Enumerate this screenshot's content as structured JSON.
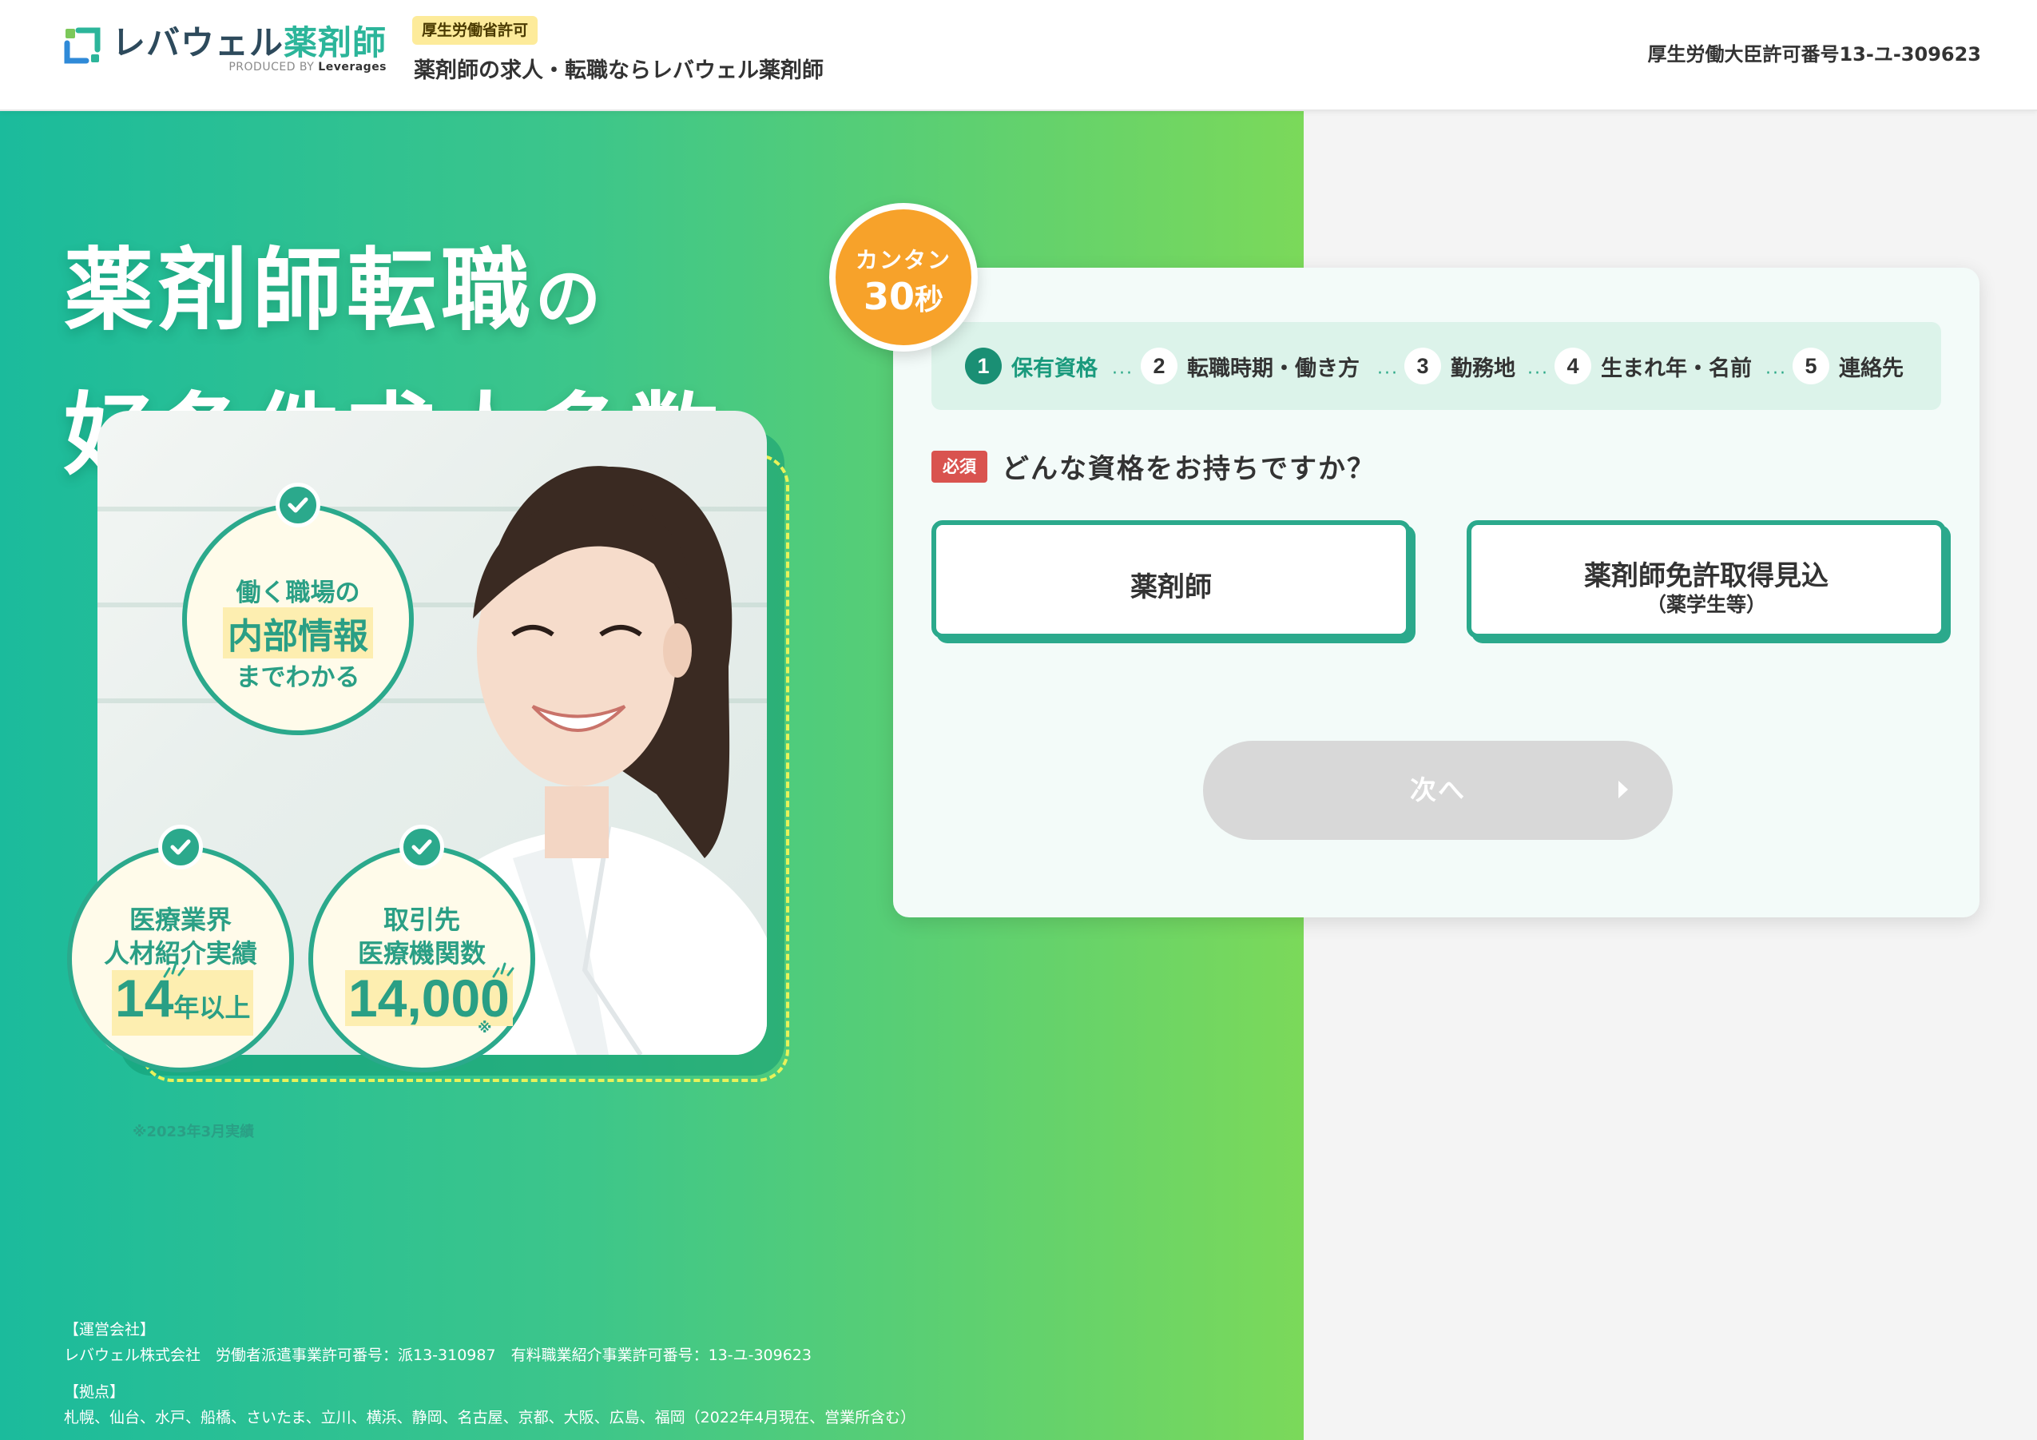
{
  "header": {
    "logo_text_main": "レバウェル",
    "logo_text_accent": "薬剤師",
    "logo_sub_prefix": "PRODUCED BY",
    "logo_sub_brand": "Leverages",
    "permit_badge": "厚生労働省許可",
    "tagline": "薬剤師の求人・転職ならレバウェル薬剤師",
    "license": "厚生労働大臣許可番号13-ユ-309623"
  },
  "hero": {
    "title_line1_main": "薬剤師転職",
    "title_line1_particle": "の",
    "title_line2": "好条件求人多数",
    "features": [
      {
        "line1": "働く職場の",
        "line2": "内部情報",
        "line3": "までわかる"
      },
      {
        "line1": "医療業界",
        "line2": "人材紹介実績",
        "number": "14",
        "unit": "年以上"
      },
      {
        "line1": "取引先",
        "line2": "医療機関数",
        "number": "14,000",
        "mark": "※"
      }
    ],
    "note": "※2023年3月実績"
  },
  "footer": {
    "company_heading": "【運営会社】",
    "company_line": "レバウェル株式会社　労働者派遣事業許可番号：派13-310987　有料職業紹介事業許可番号：13-ユ-309623",
    "bases_heading": "【拠点】",
    "bases_line": "札幌、仙台、水戸、船橋、さいたま、立川、横浜、静岡、名古屋、京都、大阪、広島、福岡（2022年4月現在、営業所含む）"
  },
  "form": {
    "badge_line1": "カンタン",
    "badge_number": "30",
    "badge_unit": "秒",
    "steps": [
      {
        "num": "1",
        "label": "保有資格"
      },
      {
        "num": "2",
        "label": "転職時期・働き方"
      },
      {
        "num": "3",
        "label": "勤務地"
      },
      {
        "num": "4",
        "label": "生まれ年・名前"
      },
      {
        "num": "5",
        "label": "連絡先"
      }
    ],
    "active_step": 1,
    "required_label": "必須",
    "question": "どんな資格をお持ちですか？",
    "options": [
      {
        "label": "薬剤師",
        "sub": ""
      },
      {
        "label": "薬剤師免許取得見込",
        "sub": "（薬学生等）"
      }
    ],
    "next_label": "次へ"
  },
  "colors": {
    "brand_green": "#2ba98c",
    "accent_orange": "#f7a22a",
    "required_red": "#d9534f",
    "disabled_gray": "#d8d8d8"
  }
}
